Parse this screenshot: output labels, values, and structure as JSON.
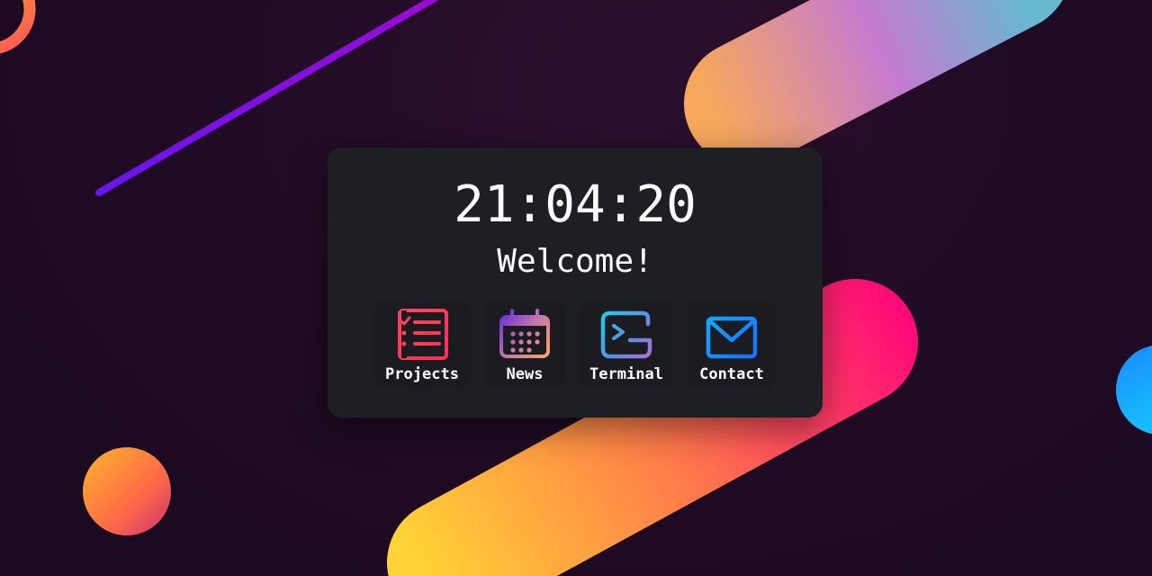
{
  "clock": {
    "time": "21:04:20"
  },
  "greeting": "Welcome!",
  "shortcuts": [
    {
      "label": "Projects",
      "icon": "task-list-icon"
    },
    {
      "label": "News",
      "icon": "calendar-icon"
    },
    {
      "label": "Terminal",
      "icon": "terminal-icon"
    },
    {
      "label": "Contact",
      "icon": "envelope-icon"
    }
  ],
  "colors": {
    "card_bg": "#1d1f25",
    "tile_bg": "#1a1c21",
    "text": "#ffffff",
    "background": "#200b24"
  }
}
